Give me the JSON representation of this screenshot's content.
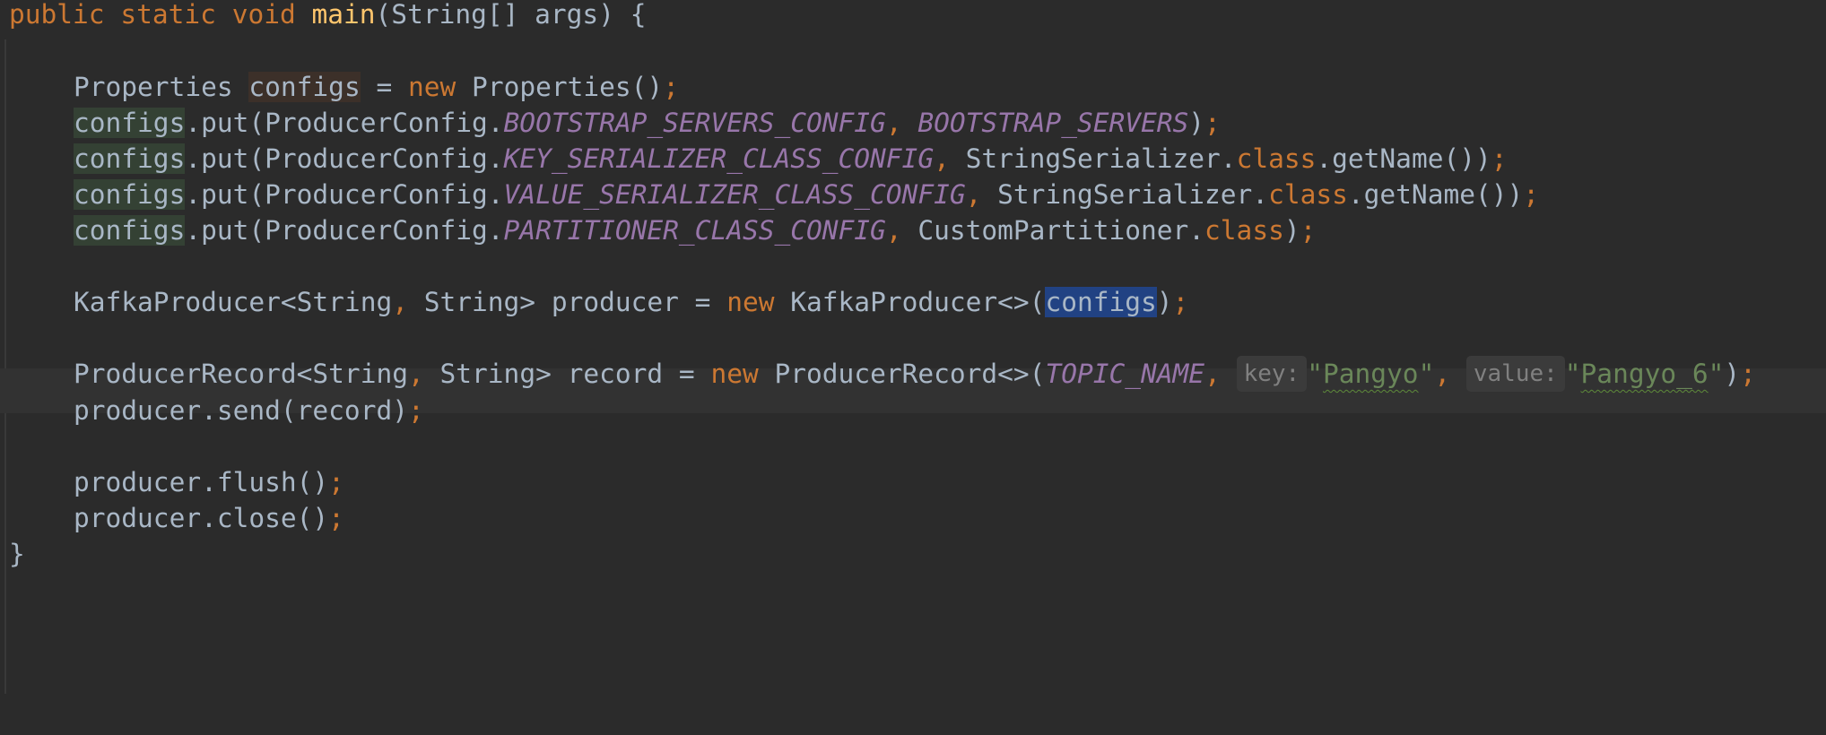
{
  "editor": {
    "line1": {
      "kw1": "public",
      "kw2": "static",
      "kw3": "void",
      "method": "main",
      "rest": "(String[] args) {"
    },
    "line2": {
      "type": "Properties",
      "var": "configs",
      "eq": " = ",
      "new": "new",
      "ctor": " Properties()",
      "semi": ";"
    },
    "put1": {
      "var": "configs",
      "call": ".put(ProducerConfig.",
      "const1": "BOOTSTRAP_SERVERS_CONFIG",
      "comma": ",",
      "const2": "BOOTSTRAP_SERVERS",
      "close": ")",
      "semi": ";"
    },
    "put2": {
      "var": "configs",
      "call": ".put(ProducerConfig.",
      "const1": "KEY_SERIALIZER_CLASS_CONFIG",
      "comma": ",",
      "mid": " StringSerializer.",
      "class_kw": "class",
      "tail": ".getName())",
      "semi": ";"
    },
    "put3": {
      "var": "configs",
      "call": ".put(ProducerConfig.",
      "const1": "VALUE_SERIALIZER_CLASS_CONFIG",
      "comma": ",",
      "mid": " StringSerializer.",
      "class_kw": "class",
      "tail": ".getName())",
      "semi": ";"
    },
    "put4": {
      "var": "configs",
      "call": ".put(ProducerConfig.",
      "const1": "PARTITIONER_CLASS_CONFIG",
      "comma": ",",
      "mid": " CustomPartitioner.",
      "class_kw": "class",
      "tail": ")",
      "semi": ";"
    },
    "producer_line": {
      "type1": "KafkaProducer<String",
      "comma": ",",
      "type2": " String> producer = ",
      "new": "new",
      "ctor": " KafkaProducer<>(",
      "var": "configs",
      "close": ")",
      "semi": ";"
    },
    "record_line": {
      "type1": "ProducerRecord<String",
      "comma1": ",",
      "type2": " String> record = ",
      "new": "new",
      "ctor": " ProducerRecord<>(",
      "const": "TOPIC_NAME",
      "comma2": ",",
      "hint_key": "key:",
      "str_key": "\"Pangyo\"",
      "comma3": ",",
      "hint_value": "value:",
      "str_value": "\"Pangyo_6\"",
      "close": ")",
      "semi": ";"
    },
    "send_line": {
      "code": "producer.send(record)",
      "semi": ";"
    },
    "flush_line": {
      "code": "producer.flush()",
      "semi": ";"
    },
    "close_line": {
      "code": "producer.close()",
      "semi": ";"
    },
    "closing_brace": "}"
  },
  "colors": {
    "background": "#2b2b2b",
    "keyword": "#cc7832",
    "method_decl": "#ffc66d",
    "constant": "#9876aa",
    "string": "#6a8759",
    "default_text": "#a9b7c6",
    "selection": "#214283"
  }
}
